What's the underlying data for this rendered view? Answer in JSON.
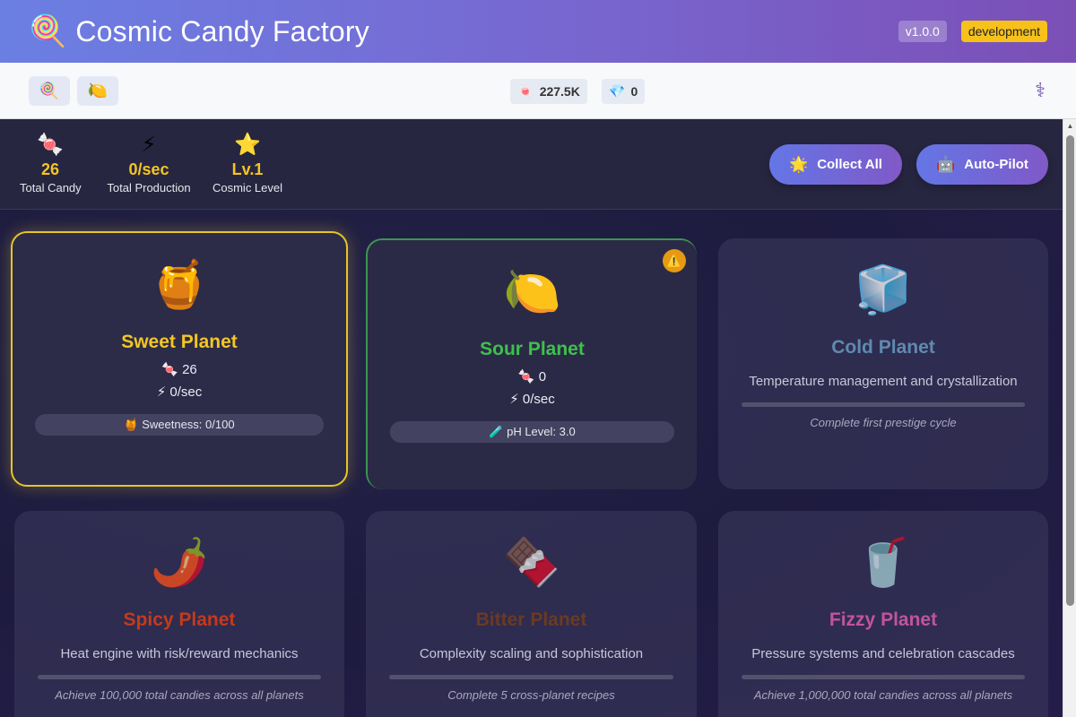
{
  "header": {
    "logo_icon": "🍭",
    "title": "Cosmic Candy Factory",
    "version": "v1.0.0",
    "environment": "development"
  },
  "toolbar": {
    "planet_tabs": [
      {
        "icon": "🍭",
        "name": "lollipop-icon"
      },
      {
        "icon": "🍋",
        "name": "lemon-icon"
      }
    ],
    "currencies": [
      {
        "icon": "🍬",
        "value": "227.5K"
      },
      {
        "icon": "💎",
        "value": "0"
      }
    ],
    "settings_icon": "⚕"
  },
  "stats": [
    {
      "icon": "🍬",
      "value": "26",
      "label": "Total Candy"
    },
    {
      "icon": "⚡",
      "value": "0/sec",
      "label": "Total Production"
    },
    {
      "icon": "⭐",
      "value": "Lv.1",
      "label": "Cosmic Level"
    }
  ],
  "actions": {
    "collect_all": {
      "icon": "🌟",
      "label": "Collect All"
    },
    "auto_pilot": {
      "icon": "🤖",
      "label": "Auto-Pilot"
    }
  },
  "planets": [
    {
      "icon": "🍯",
      "name": "Sweet Planet",
      "color": "#f2c623",
      "candy": "🍬 26",
      "rate": "⚡ 0/sec",
      "meter": "🍯 Sweetness: 0/100"
    },
    {
      "icon": "🍋",
      "name": "Sour Planet",
      "color": "#3fc04d",
      "candy": "🍬 0",
      "rate": "⚡ 0/sec",
      "meter": "🧪 pH Level: 3.0",
      "warning_icon": "⚠️"
    },
    {
      "icon": "🧊",
      "name": "Cold Planet",
      "color": "#5f8ab0",
      "description": "Temperature management and crystallization",
      "unlock": "Complete first prestige cycle"
    },
    {
      "icon": "🌶️",
      "name": "Spicy Planet",
      "color": "#c43a1c",
      "description": "Heat engine with risk/reward mechanics",
      "unlock": "Achieve 100,000 total candies across all planets"
    },
    {
      "icon": "🍫",
      "name": "Bitter Planet",
      "color": "#6b3a22",
      "description": "Complexity scaling and sophistication",
      "unlock": "Complete 5 cross-planet recipes"
    },
    {
      "icon": "🥤",
      "name": "Fizzy Planet",
      "color": "#c2549a",
      "description": "Pressure systems and celebration cascades",
      "unlock": "Achieve 1,000,000 total candies across all planets"
    }
  ]
}
